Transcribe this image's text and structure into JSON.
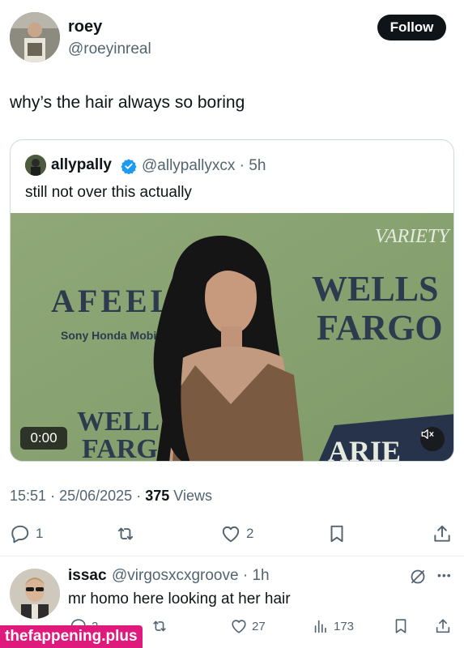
{
  "author": {
    "name": "roey",
    "handle": "@roeyinreal",
    "follow_label": "Follow"
  },
  "tweet": {
    "text": "why’s the hair always so boring"
  },
  "quote": {
    "name": "allypally",
    "handle_time": "@allypallyxcx · 5h",
    "text": "still not over this actually",
    "video": {
      "timecode": "0:00",
      "logo_variety": "VARIETY",
      "sign_afeel": "AFEEL",
      "sign_sony": "Sony Honda Mobil",
      "sign_wells_line1": "WELLS",
      "sign_wells_line2": "FARGO",
      "sign_wells_bottom1": "WELL",
      "sign_wells_bottom2": "FARG",
      "sign_variety_bottom": "ARIE"
    }
  },
  "meta": {
    "time": "15:51",
    "date": "25/06/2025",
    "views_count": "375",
    "views_label": "Views"
  },
  "actions": {
    "replies": "1",
    "retweets": "",
    "likes": "2"
  },
  "reply": {
    "name": "issac",
    "handle_time": "@virgosxcxgroove · 1h",
    "text": "mr homo here looking at her hair",
    "actions": {
      "replies": "2",
      "likes": "27",
      "views": "173"
    }
  },
  "watermark": "thefappening.plus",
  "icons": [
    "reply-icon",
    "retweet-icon",
    "like-icon",
    "bookmark-icon",
    "share-icon",
    "views-icon",
    "grok-icon",
    "more-icon",
    "mute-icon",
    "verified-icon"
  ],
  "colors": {
    "text": "#0f1419",
    "secondary": "#536471",
    "verified": "#1d9bf0",
    "watermark": "#e0197d"
  }
}
